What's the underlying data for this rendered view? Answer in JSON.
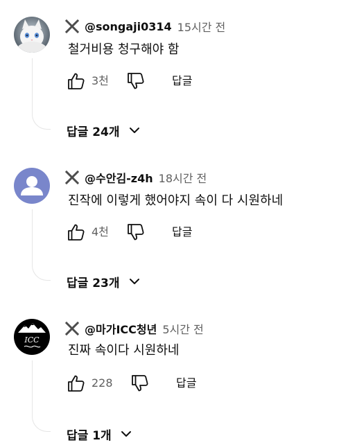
{
  "comments": [
    {
      "author": "@songaji0314",
      "time": "15시간 전",
      "text": "철거비용 청구해야 함",
      "likes": "3천",
      "reply_label": "답글",
      "replies_label": "답글 24개",
      "avatar_icon": "white-cat-avatar"
    },
    {
      "author": "@수안김-z4h",
      "time": "18시간 전",
      "text": "진작에 이렇게 했어야지 속이 다 시원하네",
      "likes": "4천",
      "reply_label": "답글",
      "replies_label": "답글 23개",
      "avatar_icon": "default-person-avatar"
    },
    {
      "author": "@마가ICC청년",
      "time": "5시간 전",
      "text": "진짜 속이다 시원하네",
      "likes": "228",
      "reply_label": "답글",
      "replies_label": "답글 1개",
      "avatar_icon": "icc-mountain-logo-avatar",
      "avatar_logo_text": "ICC"
    }
  ],
  "colors": {
    "text": "#0f0f0f",
    "secondary": "#606060",
    "thread_line": "#e5e5e5",
    "avatar_purple": "#7986cb"
  },
  "icons": {
    "badge": "x-mark-icon",
    "like": "thumb-up-icon",
    "dislike": "thumb-down-icon",
    "expand": "chevron-down-icon"
  }
}
